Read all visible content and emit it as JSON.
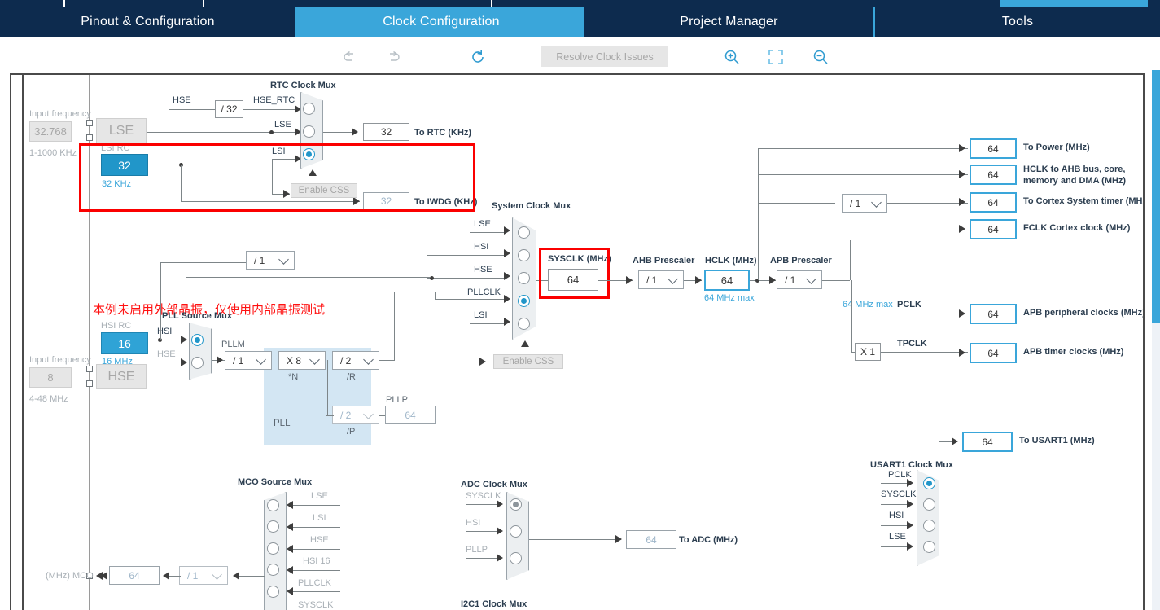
{
  "window": {
    "tabs": [
      {
        "label": "Pinout & Configuration",
        "active": false
      },
      {
        "label": "Clock Configuration",
        "active": true
      },
      {
        "label": "Project Manager",
        "active": false
      },
      {
        "label": "Tools",
        "active": false
      }
    ]
  },
  "toolbar": {
    "undo_icon": "undo-icon",
    "redo_icon": "redo-icon",
    "reset_icon": "reset-icon",
    "resolve_label": "Resolve Clock Issues",
    "zoom_in_icon": "zoom-in-icon",
    "fit_icon": "fit-to-screen-icon",
    "zoom_out_icon": "zoom-out-icon"
  },
  "colors": {
    "accent": "#3aa6da",
    "tab_inactive": "#0d2b4e",
    "highlight_box": "#2196c9",
    "annotation_red": "#fb0000",
    "wire": "#7d8588"
  },
  "annotations": {
    "note_cn": "本例未启用外部晶振，仅使用内部晶振测试",
    "box_lsi_title": "lsi-highlight-box",
    "box_sysclk_title": "sysclk-highlight-box"
  },
  "lse_section": {
    "input_frequency_label": "Input frequency",
    "input_frequency_value": "32.768",
    "range": "1-1000 KHz",
    "osc_label": "LSE"
  },
  "hse_section": {
    "input_frequency_label": "Input frequency",
    "input_frequency_value": "8",
    "range": "4-48 MHz",
    "osc_label": "HSE"
  },
  "lsi_rc": {
    "title": "LSI RC",
    "value": "32",
    "unit": "32 KHz"
  },
  "hsi_rc": {
    "title": "HSI RC",
    "value": "16",
    "unit": "16 MHz"
  },
  "rtc_mux": {
    "title": "RTC Clock Mux",
    "inputs": [
      {
        "label": "HSE_RTC",
        "selected": false
      },
      {
        "label": "LSE",
        "selected": false
      },
      {
        "label": "LSI",
        "selected": true
      }
    ],
    "hse_label": "HSE",
    "hse_divider": "/ 32",
    "enable_css_label": "Enable CSS",
    "to_rtc_value": "32",
    "to_rtc_label": "To RTC (KHz)",
    "to_iwdg_value": "32",
    "to_iwdg_label": "To IWDG (KHz)"
  },
  "pll_source_mux": {
    "title": "PLL Source Mux",
    "inputs": [
      {
        "label": "HSI",
        "selected": true
      },
      {
        "label": "HSE",
        "selected": false
      }
    ]
  },
  "pll": {
    "region_label": "PLL",
    "pllm_label": "PLLM",
    "pllm_value": "/ 1",
    "n_value": "X 8",
    "n_label": "*N",
    "r_value": "/ 2",
    "r_label": "/R",
    "p_value": "/ 2",
    "p_label": "/P",
    "pllp_label": "PLLP",
    "pllp_value": "64"
  },
  "system_clock_mux": {
    "title": "System Clock Mux",
    "inputs": [
      {
        "label": "LSE",
        "selected": false
      },
      {
        "label": "HSI",
        "selected": false
      },
      {
        "label": "HSE",
        "selected": false
      },
      {
        "label": "PLLCLK",
        "selected": true
      },
      {
        "label": "LSI",
        "selected": false
      }
    ],
    "enable_css_label": "Enable CSS"
  },
  "sysclk": {
    "label": "SYSCLK (MHz)",
    "value": "64"
  },
  "ahb_prescaler": {
    "label": "AHB Prescaler",
    "value": "/ 1"
  },
  "hclk": {
    "label": "HCLK (MHz)",
    "value": "64",
    "max_note": "64 MHz max"
  },
  "apb_prescaler": {
    "label": "APB Prescaler",
    "value": "/ 1",
    "max_note": "64 MHz max"
  },
  "apb_timer_multiplier": {
    "value": "X 1"
  },
  "cortex_prescaler": {
    "value": "/ 1"
  },
  "pclk_label": "PCLK",
  "tpclk_label": "TPCLK",
  "outputs": [
    {
      "value": "64",
      "label": "To Power (MHz)"
    },
    {
      "value": "64",
      "label": "HCLK to AHB bus, core, memory and DMA (MHz)"
    },
    {
      "value": "64",
      "label": "To Cortex System timer (MHz)"
    },
    {
      "value": "64",
      "label": "FCLK Cortex clock (MHz)"
    },
    {
      "value": "64",
      "label": "APB peripheral clocks (MHz)"
    },
    {
      "value": "64",
      "label": "APB timer clocks (MHz)"
    }
  ],
  "usart1_mux": {
    "title": "USART1 Clock Mux",
    "inputs": [
      {
        "label": "PCLK",
        "selected": true
      },
      {
        "label": "SYSCLK",
        "selected": false
      },
      {
        "label": "HSI",
        "selected": false
      },
      {
        "label": "LSE",
        "selected": false
      }
    ],
    "output_value": "64",
    "output_label": "To USART1 (MHz)"
  },
  "mco_mux": {
    "title": "MCO Source Mux",
    "inputs": [
      {
        "label": "LSE",
        "selected": false
      },
      {
        "label": "LSI",
        "selected": false
      },
      {
        "label": "HSE",
        "selected": false
      },
      {
        "label": "HSI 16",
        "selected": false
      },
      {
        "label": "PLLCLK",
        "selected": false
      },
      {
        "label": "SYSCLK",
        "selected": false
      }
    ],
    "divider_value": "/ 1",
    "output_value": "64",
    "output_label": "(MHz) MCO"
  },
  "adc_mux": {
    "title": "ADC Clock Mux",
    "inputs": [
      {
        "label": "SYSCLK",
        "selected": true
      },
      {
        "label": "HSI",
        "selected": false
      },
      {
        "label": "PLLP",
        "selected": false
      }
    ],
    "output_value": "64",
    "output_label": "To ADC (MHz)"
  },
  "i2c1_mux": {
    "title": "I2C1 Clock Mux"
  }
}
